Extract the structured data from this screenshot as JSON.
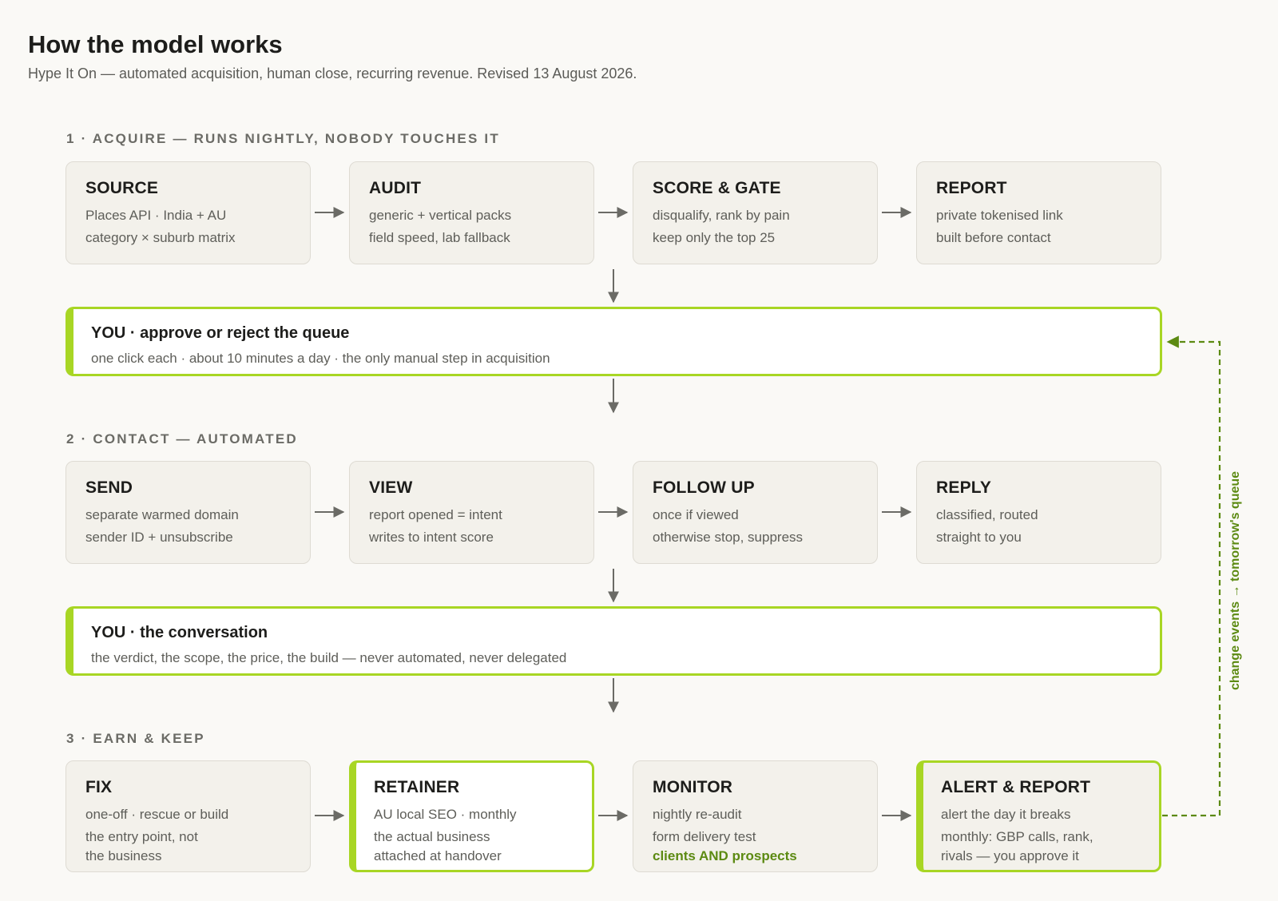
{
  "header": {
    "title": "How the model works",
    "subtitle": "Hype It On — automated acquisition, human close, recurring revenue. Revised 13 August 2026."
  },
  "sections": [
    {
      "heading": "1 · ACQUIRE — RUNS NIGHTLY, NOBODY TOUCHES IT",
      "cards": [
        {
          "title": "SOURCE",
          "lines": [
            "Places API · India + AU",
            "category × suburb matrix"
          ]
        },
        {
          "title": "AUDIT",
          "lines": [
            "generic + vertical packs",
            "field speed, lab fallback"
          ]
        },
        {
          "title": "SCORE & GATE",
          "lines": [
            "disqualify, rank by pain",
            "keep only the top 25"
          ]
        },
        {
          "title": "REPORT",
          "lines": [
            "private tokenised link",
            "built before contact"
          ]
        }
      ],
      "you": {
        "title": "YOU · approve or reject the queue",
        "subtitle": "one click each · about 10 minutes a day · the only manual step in acquisition"
      }
    },
    {
      "heading": "2 · CONTACT — AUTOMATED",
      "cards": [
        {
          "title": "SEND",
          "lines": [
            "separate warmed domain",
            "sender ID + unsubscribe"
          ]
        },
        {
          "title": "VIEW",
          "lines": [
            "report opened = intent",
            "writes to intent score"
          ]
        },
        {
          "title": "FOLLOW UP",
          "lines": [
            "once if viewed",
            "otherwise stop, suppress"
          ]
        },
        {
          "title": "REPLY",
          "lines": [
            "classified, routed",
            "straight to you"
          ]
        }
      ],
      "you": {
        "title": "YOU · the conversation",
        "subtitle": "the verdict, the scope, the price, the build — never automated, never delegated"
      }
    },
    {
      "heading": "3 · EARN & KEEP",
      "cards": [
        {
          "title": "FIX",
          "lines": [
            "one-off · rescue or build",
            "the entry point, not",
            "the business"
          ]
        },
        {
          "title": "RETAINER",
          "lines": [
            "AU local SEO · monthly",
            "the actual business",
            "attached at handover"
          ]
        },
        {
          "title": "MONITOR",
          "lines": [
            "nightly re-audit",
            "form delivery test",
            "clients AND prospects"
          ]
        },
        {
          "title": "ALERT & REPORT",
          "lines": [
            "alert the day it breaks",
            "monthly: GBP calls, rank,",
            "rivals — you approve it"
          ]
        }
      ]
    }
  ],
  "feedback_label": "change events → tomorrow's queue",
  "colors": {
    "accent": "#a8d624",
    "accent_text": "#5c8a12",
    "card_bg": "#f3f1eb",
    "card_border": "#dedbd3",
    "arrow": "#6b6b66",
    "background": "#faf9f6"
  }
}
